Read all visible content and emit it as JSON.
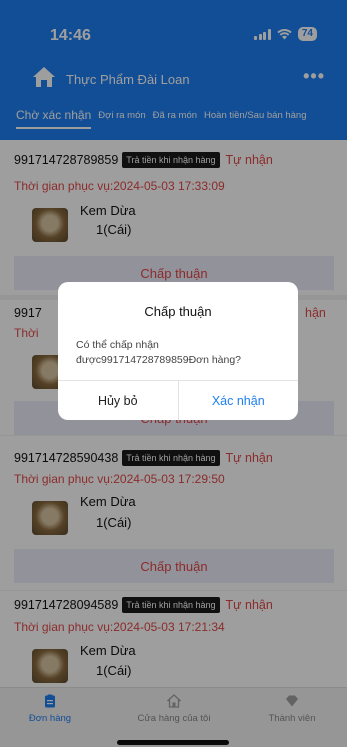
{
  "status_bar": {
    "time": "14:46",
    "battery": "74"
  },
  "app_bar": {
    "title": "Thực Phẩm Đài Loan",
    "more": "•••"
  },
  "tabs": [
    {
      "label": "Chờ xác nhận"
    },
    {
      "label": "Đợi ra món"
    },
    {
      "label": "Đã ra món"
    },
    {
      "label": "Hoàn tiền/Sau bán hàng"
    }
  ],
  "orders": [
    {
      "id": "991714728789859",
      "badge": "Trả tiền khi nhận hàng",
      "pickup": "Tự nhận",
      "service_time": "Thời gian phục vụ:2024-05-03 17:33:09",
      "product": "Kem Dừa",
      "qty": "1(Cái)",
      "accept": "Chấp thuận"
    },
    {
      "id": "9917",
      "pickup": "hận",
      "service_time": "Thời",
      "accept": "Chấp thuận"
    },
    {
      "id": "991714728590438",
      "badge": "Trả tiền khi nhận hàng",
      "pickup": "Tự nhận",
      "service_time": "Thời gian phục vụ:2024-05-03 17:29:50",
      "product": "Kem Dừa",
      "qty": "1(Cái)",
      "accept": "Chấp thuận"
    },
    {
      "id": "991714728094589",
      "badge": "Trả tiền khi nhận hàng",
      "pickup": "Tự nhận",
      "service_time": "Thời gian phục vụ:2024-05-03 17:21:34",
      "product": "Kem Dừa",
      "qty": "1(Cái)"
    }
  ],
  "dialog": {
    "title": "Chấp thuận",
    "message_line1": "Có thể chấp nhận",
    "message_line2": "được991714728789859Đơn hàng?",
    "cancel": "Hủy bỏ",
    "confirm": "Xác nhận"
  },
  "bottom_nav": [
    {
      "label": "Đơn hàng",
      "icon": "order-list-icon"
    },
    {
      "label": "Cửa hàng của tôi",
      "icon": "store-icon"
    },
    {
      "label": "Thành viên",
      "icon": "member-diamond-icon"
    }
  ],
  "colors": {
    "brand": "#1e7ef0",
    "accent_red": "#e04848",
    "accept_bg": "#ececf9"
  }
}
